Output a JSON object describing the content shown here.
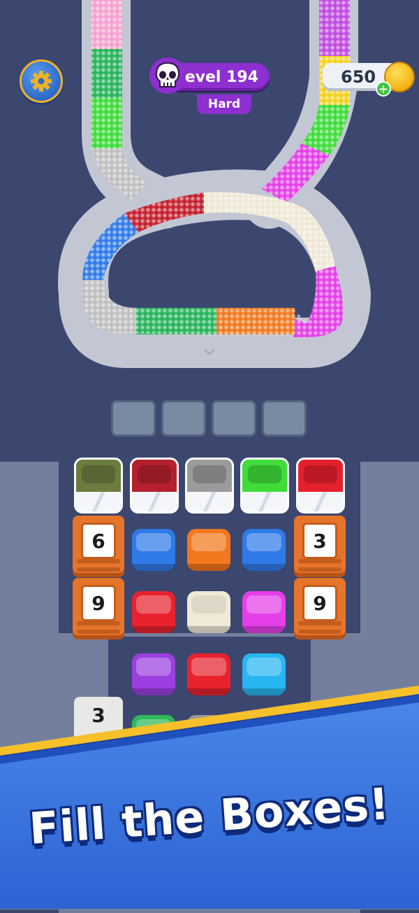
{
  "hud": {
    "level_label": "Level 194",
    "difficulty": "Hard",
    "coins": "650",
    "coin_plus": "+"
  },
  "board": {
    "top_boxes": [
      {
        "color": "#6b7d3e"
      },
      {
        "color": "#b5202e"
      },
      {
        "color": "#9b9b9b"
      },
      {
        "color": "#3fdc3a"
      },
      {
        "color": "#e5202e"
      }
    ],
    "crates": [
      {
        "count": "6"
      },
      {
        "count": "3"
      },
      {
        "count": "9"
      },
      {
        "count": "9"
      }
    ],
    "white_crate": {
      "count": "3"
    },
    "boxes": [
      {
        "color": "#2f7ae8"
      },
      {
        "color": "#f2781d"
      },
      {
        "color": "#2f7ae8"
      },
      {
        "color": "#e8232e"
      },
      {
        "color": "#efe9d8"
      },
      {
        "color": "#e43fe8"
      },
      {
        "color": "#9b3fe0"
      },
      {
        "color": "#e8232e"
      },
      {
        "color": "#27b6f2"
      },
      {
        "color": "#2fb85a"
      },
      {
        "color": "#9a9a9a"
      }
    ]
  },
  "banner": {
    "headline": "Fill the Boxes!"
  }
}
